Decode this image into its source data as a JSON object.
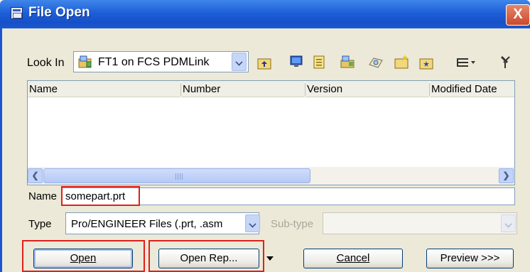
{
  "window": {
    "title": "File Open",
    "close_glyph": "X"
  },
  "lookin": {
    "label": "Look In",
    "value": "FT1 on FCS PDMLink",
    "icon": "server-folder-icon"
  },
  "toolbar": {
    "icons": [
      "up-folder-icon",
      "desktop-icon",
      "new-document-icon",
      "commonspace-icon",
      "network-icon",
      "new-folder-icon",
      "favorites-folder-icon",
      "view-menu-icon",
      "pin-icon"
    ]
  },
  "filelist": {
    "columns": [
      "Name",
      "Number",
      "Version",
      "Modified Date"
    ],
    "rows": []
  },
  "name_field": {
    "label": "Name",
    "value": "somepart.prt"
  },
  "type_field": {
    "label": "Type",
    "value": "Pro/ENGINEER Files (.prt, .asm"
  },
  "subtype_field": {
    "label": "Sub-type",
    "value": ""
  },
  "buttons": {
    "open": "Open",
    "open_rep": "Open Rep...",
    "cancel": "Cancel",
    "preview": "Preview >>>"
  },
  "colors": {
    "titlebar": "#1d5fd8",
    "dialog": "#ece9d8",
    "highlight": "#e0201b"
  }
}
